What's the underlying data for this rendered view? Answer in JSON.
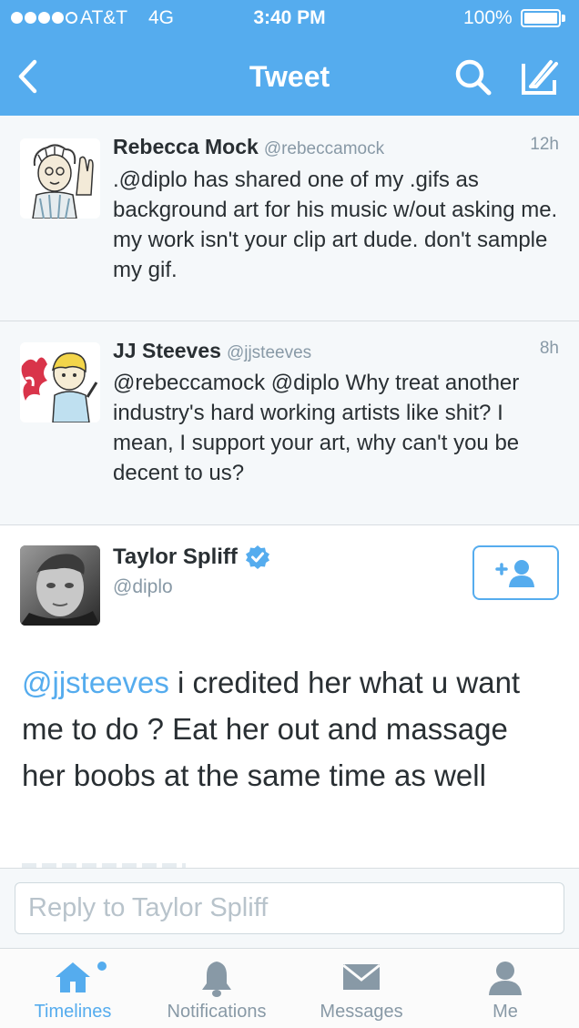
{
  "status_bar": {
    "carrier": "AT&T",
    "network": "4G",
    "time": "3:40 PM",
    "battery": "100%"
  },
  "nav": {
    "title": "Tweet",
    "icons": [
      "chevron-left-icon",
      "search-icon",
      "compose-icon"
    ]
  },
  "tweets": [
    {
      "name": "Rebecca Mock",
      "handle": "@rebeccamock",
      "time": "12h",
      "text": ".@diplo has shared one of my .gifs as background art for his music w/out asking me. my work isn't your clip art dude. don't sample my gif."
    },
    {
      "name": "JJ Steeves",
      "handle": "@jjsteeves",
      "time": "8h",
      "text": "@rebeccamock @diplo Why treat another industry's hard working artists like shit? I mean, I support your art, why can't you be decent to us?"
    }
  ],
  "main_tweet": {
    "name": "Taylor Spliff",
    "handle": "@diplo",
    "mention": "@jjsteeves",
    "text": " i credited her what u want me to do ? Eat her out and massage her boobs at the same time as well"
  },
  "reply": {
    "placeholder": "Reply to Taylor Spliff"
  },
  "tabs": [
    {
      "label": "Timelines",
      "icon": "home-icon",
      "active": true
    },
    {
      "label": "Notifications",
      "icon": "bell-icon",
      "active": false
    },
    {
      "label": "Messages",
      "icon": "envelope-icon",
      "active": false
    },
    {
      "label": "Me",
      "icon": "person-icon",
      "active": false
    }
  ],
  "colors": {
    "brand": "#55acee",
    "text": "#292f33",
    "muted": "#8899a6"
  }
}
